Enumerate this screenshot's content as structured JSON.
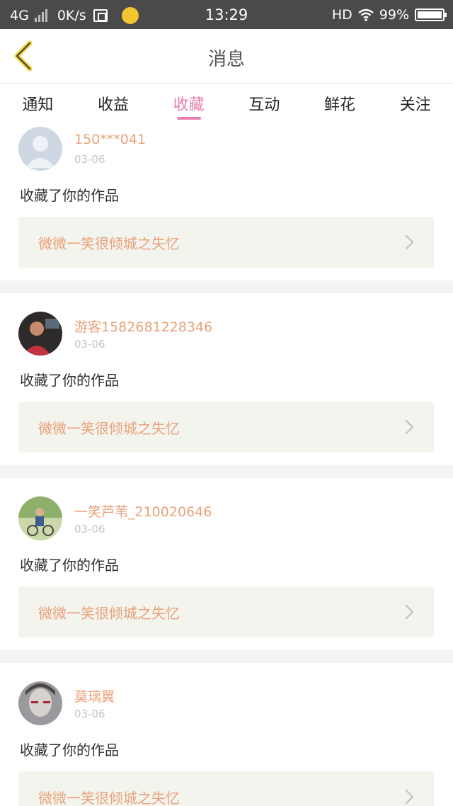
{
  "status_bar": {
    "network": "4G",
    "speed": "0K/s",
    "time": "13:29",
    "hd": "HD",
    "battery": "99%",
    "battery_level": 0.99,
    "icons": [
      "signal-icon",
      "sim-icon",
      "app-notification-icon",
      "wifi-icon",
      "battery-icon"
    ]
  },
  "nav": {
    "title": "消息",
    "back_icon": "chevron-left-icon",
    "accent_color": "#f0d23c"
  },
  "tabs": [
    {
      "label": "通知",
      "active": false
    },
    {
      "label": "收益",
      "active": false
    },
    {
      "label": "收藏",
      "active": true
    },
    {
      "label": "互动",
      "active": false
    },
    {
      "label": "鲜花",
      "active": false
    },
    {
      "label": "关注",
      "active": false
    }
  ],
  "colors": {
    "active_tab": "#ea7db0",
    "username": "#e8a27a",
    "work_title": "#e8a27a",
    "date": "#c4c4c4",
    "work_box_bg": "#f4f4ee"
  },
  "messages": [
    {
      "user": "150***041",
      "date": "03-06",
      "action": "收藏了你的作品",
      "work": "微微一笑很倾城之失忆",
      "avatar": "default-avatar"
    },
    {
      "user": "游客1582681228346",
      "date": "03-06",
      "action": "收藏了你的作品",
      "work": "微微一笑很倾城之失忆",
      "avatar": "photo-avatar-red"
    },
    {
      "user": "一笑芦苇_210020646",
      "date": "03-06",
      "action": "收藏了你的作品",
      "work": "微微一笑很倾城之失忆",
      "avatar": "photo-avatar-green"
    },
    {
      "user": "莫璃翼",
      "date": "03-06",
      "action": "收藏了你的作品",
      "work": "微微一笑很倾城之失忆",
      "avatar": "photo-avatar-gray"
    }
  ]
}
